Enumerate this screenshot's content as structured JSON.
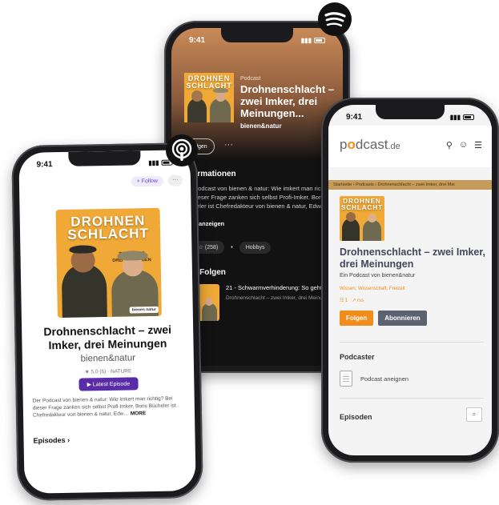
{
  "colors": {
    "cover_orange": "#f0a836",
    "spotify_bg": "#121212",
    "apple_purple": "#5a2da8",
    "podcastde_orange": "#f28c1b",
    "podcastde_gray": "#5b6270"
  },
  "cover": {
    "title_line1": "DROHNEN",
    "title_line2": "SCHLACHT",
    "subtitle": "ZWEI IMKER",
    "subtitle2": "DREI MEINUNGEN",
    "logo": "bienen natur"
  },
  "spotify": {
    "time": "9:41",
    "type_label": "Podcast",
    "title": "Drohnenschlacht – zwei Imker, drei Meinungen...",
    "author": "bienen&natur",
    "follow_label": "Folgen",
    "more_label": "···",
    "info_heading": "Informationen",
    "description": "Der Podcast von bienen & natur: Wie imkert man richtig? Bei dieser Frage zanken sich selbst Profi-Imker. Boris Bücheler ist Chefredakteur von bienen & natur, Edward Obik",
    "show_more": "Mehr anzeigen",
    "rating": "4,9 ☆ (258)",
    "chip": "Hobbys",
    "episodes_heading": "Alle Folgen",
    "episode_title": "21 - Schwarmverhinderung: So geht's",
    "episode_sub": "Drohnenschlacht – zwei Imker, drei Meinungen"
  },
  "apple": {
    "time": "9:41",
    "follow_label": "+ Follow",
    "more_label": "···",
    "title": "Drohnenschlacht – zwei Imker, drei Meinungen",
    "author": "bienen&natur",
    "rating": "★ 5,0 (6) · NATURE",
    "latest_button": "▶ Latest Episode",
    "description": "Der Podcast von bienen & natur: Wie imkert man richtig? Bei dieser Frage zanken sich selbst Profi-Imker. Boris Bücheler ist Chefredakteur von bienen & natur, Edw…",
    "more": "MORE",
    "episodes_label": "Episodes ›"
  },
  "podcastde": {
    "time": "9:41",
    "logo_pod": "p",
    "logo_o": "o",
    "logo_rest": "dcast",
    "logo_de": ".de",
    "breadcrumb": "Startseite › Podcasts › Drohnenschlacht – zwei Imker, drei Mei",
    "title": "Drohnenschlacht – zwei Imker, drei Meinungen",
    "by_line": "Ein Podcast von bienen&natur",
    "categories": "Wissen, Wissenschaft, Freizeit",
    "count_episodes": "☷ 1",
    "count_rss": "↗ rss",
    "follow_button": "Folgen",
    "subscribe_button": "Abonnieren",
    "podcaster_heading": "Podcaster",
    "claim_label": "Podcast aneignen",
    "episodes_heading": "Episoden",
    "search_icon_label": "⌕"
  },
  "icons": {
    "spotify_badge": "spotify-logo-icon",
    "apple_badge": "apple-podcasts-logo-icon"
  }
}
